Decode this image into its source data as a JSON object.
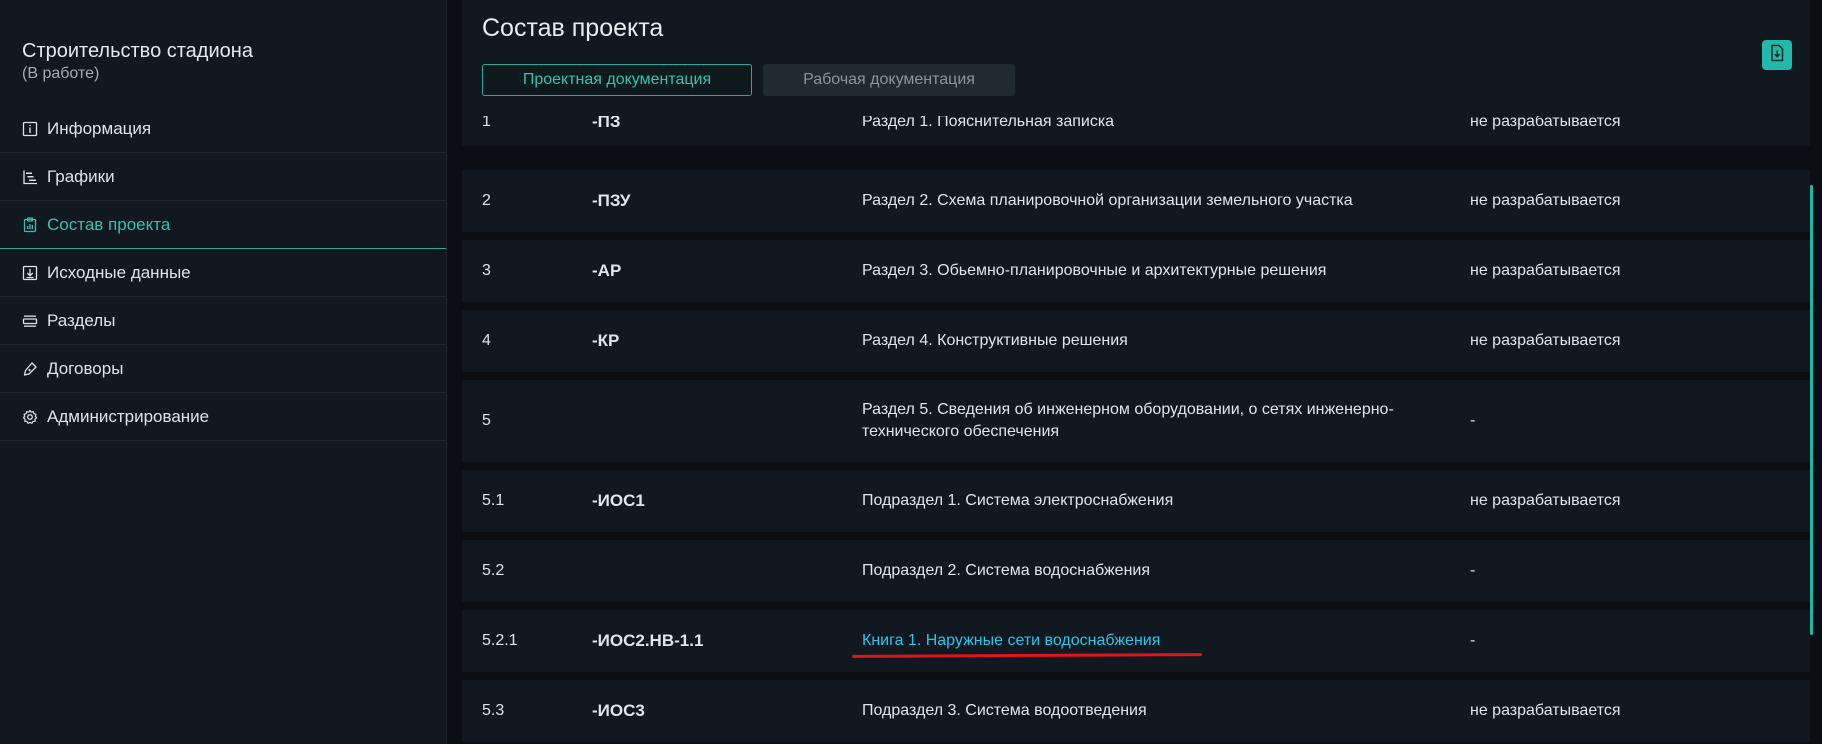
{
  "sidebar": {
    "project_title": "Строительство стадиона",
    "project_status": "(В работе)",
    "items": [
      {
        "label": "Информация",
        "icon": "info-icon"
      },
      {
        "label": "Графики",
        "icon": "gantt-chart-icon"
      },
      {
        "label": "Состав проекта",
        "icon": "clipboard-chart-icon",
        "active": true
      },
      {
        "label": "Исходные данные",
        "icon": "download-box-icon"
      },
      {
        "label": "Разделы",
        "icon": "layers-icon"
      },
      {
        "label": "Договоры",
        "icon": "pen-icon"
      },
      {
        "label": "Администрирование",
        "icon": "gear-icon"
      }
    ]
  },
  "header": {
    "title": "Состав проекта",
    "tabs": [
      {
        "label": "Проектная документация",
        "active": true
      },
      {
        "label": "Рабочая документация",
        "active": false
      }
    ],
    "export_icon": "file-download-icon"
  },
  "colors": {
    "accent": "#2aa899",
    "link": "#29c4e8",
    "annotation": "#e0141e"
  },
  "table": {
    "rows": [
      {
        "num": "1",
        "code": "-ПЗ",
        "name": "Раздел 1. Пояснительная записка",
        "status": "не разрабатывается"
      },
      {
        "num": "2",
        "code": "-ПЗУ",
        "name": "Раздел 2. Схема планировочной организации земельного участка",
        "status": "не разрабатывается"
      },
      {
        "num": "3",
        "code": "-АР",
        "name": "Раздел 3. Обьемно-планировочные и архитектурные решения",
        "status": "не разрабатывается"
      },
      {
        "num": "4",
        "code": "-КР",
        "name": "Раздел 4. Конструктивные решения",
        "status": "не разрабатывается"
      },
      {
        "num": "5",
        "code": "",
        "name": "Раздел 5. Сведения об инженерном оборудовании, о сетях инженерно-технического обеспечения",
        "status": "-"
      },
      {
        "num": "5.1",
        "code": "-ИОС1",
        "name": "Подраздел 1. Система электроснабжения",
        "status": "не разрабатывается"
      },
      {
        "num": "5.2",
        "code": "",
        "name": "Подраздел 2. Система водоснабжения",
        "status": "-"
      },
      {
        "num": "5.2.1",
        "code": "-ИОС2.НВ-1.1",
        "name": "Книга 1. Наружные сети водоснабжения",
        "status": "-",
        "link": true
      },
      {
        "num": "5.3",
        "code": "-ИОС3",
        "name": "Подраздел 3. Система водоотведения",
        "status": "не разрабатывается"
      }
    ]
  }
}
